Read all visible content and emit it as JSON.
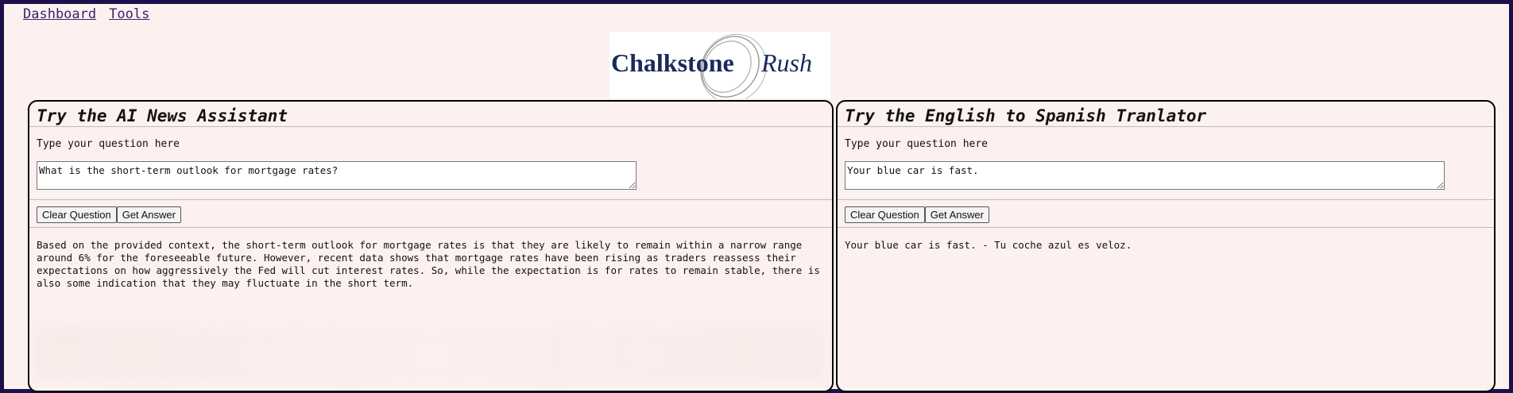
{
  "nav": {
    "dashboard": "Dashboard",
    "tools": "Tools"
  },
  "logo": {
    "word1": "Chalkstone",
    "word2": "Rush"
  },
  "left_panel": {
    "title": "Try the AI News Assistant",
    "prompt_label": "Type your question here",
    "input_value": "What is the short-term outlook for mortgage rates?",
    "clear_label": "Clear Question",
    "get_label": "Get Answer",
    "answer": "Based on the provided context, the short-term outlook for mortgage rates is that they are likely to remain within a narrow range\naround 6% for the foreseeable future. However, recent data shows that mortgage rates have been rising as traders reassess their\nexpectations on how aggressively the Fed will cut interest rates. So, while the expectation is for rates to remain stable, there is\nalso some indication that they may fluctuate in the short term."
  },
  "right_panel": {
    "title": "Try the English to Spanish Tranlator",
    "prompt_label": "Type your question here",
    "input_value": "Your blue car is fast.",
    "clear_label": "Clear Question",
    "get_label": "Get Answer",
    "answer": "Your blue car is fast. - Tu coche azul es veloz."
  },
  "colors": {
    "background": "#fcf1ef",
    "frame": "#1c0f4a",
    "logo_navy": "#1b2a5c",
    "link": "#3a1f6e"
  }
}
